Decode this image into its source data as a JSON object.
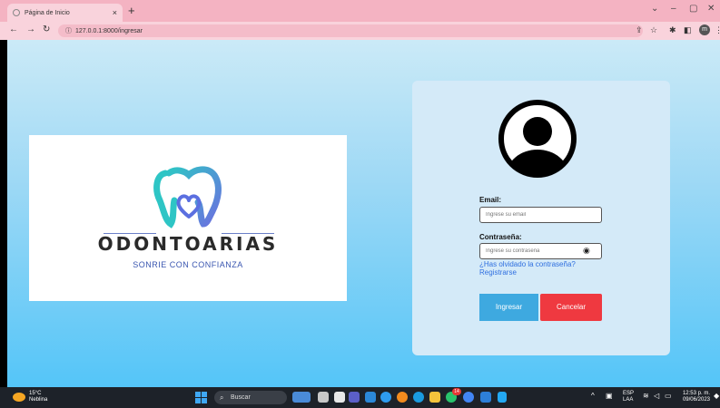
{
  "browser": {
    "tab_title": "Página de Inicio",
    "tab_close": "×",
    "new_tab": "+",
    "url": "127.0.0.1:8000/ingresar",
    "window_controls": [
      "⌄",
      "–",
      "▢",
      "✕"
    ]
  },
  "logo": {
    "name": "ODONTOARIAS",
    "tagline": "SONRIE CON CONFIANZA"
  },
  "login": {
    "email_label": "Email:",
    "email_placeholder": "Ingrese su email",
    "password_label": "Contraseña:",
    "password_placeholder": "Ingrese su contraseña",
    "forgot_link": "¿Has olvidado la contraseña?",
    "register_link": "Registrarse",
    "submit_label": "Ingresar",
    "cancel_label": "Cancelar"
  },
  "taskbar": {
    "temperature": "15°C",
    "weather": "Neblina",
    "search_label": "Buscar",
    "language": "ESP",
    "keyboard": "LAA",
    "time": "12:53 p. m.",
    "date": "09/06/2023",
    "badge_count": "14"
  },
  "colors": {
    "accent_blue": "#3ea9e0",
    "cancel_red": "#ef3940",
    "link_blue": "#2f6fe0"
  }
}
